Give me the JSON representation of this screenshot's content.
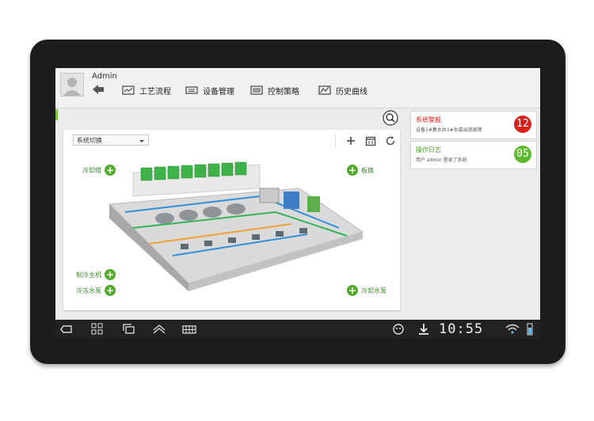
{
  "header": {
    "username": "Admin",
    "nav": [
      {
        "label": "工艺流程",
        "icon": "process-flow-icon"
      },
      {
        "label": "设备管理",
        "icon": "equipment-icon"
      },
      {
        "label": "控制策略",
        "icon": "control-icon"
      },
      {
        "label": "历史曲线",
        "icon": "history-chart-icon"
      }
    ]
  },
  "main": {
    "system_select": "系统切换",
    "callouts": [
      "冷却塔",
      "板换",
      "制冷主机",
      "冷冻水泵",
      "冷却水泵"
    ]
  },
  "notifications": [
    {
      "title": "系统警报",
      "detail": "设备1#集水井1#水泵出现故障",
      "count": "12",
      "color": "#d9211c",
      "title_color": "#d9211c"
    },
    {
      "title": "操作日志",
      "detail": "用户 admin 登录了系统",
      "count": "05",
      "color": "#5db82e",
      "title_color": "#4a9a2a"
    }
  ],
  "statusbar": {
    "time": "10:55",
    "icons": [
      "back-icon",
      "home-grid-icon",
      "recent-apps-icon",
      "menu-up-icon",
      "keyboard-icon",
      "android-icon",
      "download-icon",
      "wifi-icon",
      "battery-icon"
    ]
  }
}
